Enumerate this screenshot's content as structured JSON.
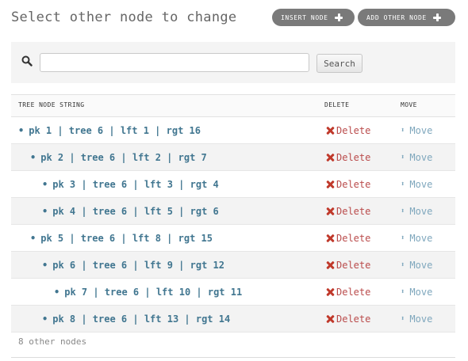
{
  "header": {
    "title": "Select other node to change",
    "insert_node_label": "INSERT NODE",
    "add_other_node_label": "ADD OTHER NODE"
  },
  "search": {
    "value": "",
    "placeholder": "",
    "button_label": "Search"
  },
  "table": {
    "columns": [
      "TREE NODE STRING",
      "DELETE",
      "MOVE"
    ],
    "rows": [
      {
        "label": "pk 1 | tree 6 | lft 1 | rgt 16",
        "depth": 0,
        "delete": "Delete",
        "move": "Move"
      },
      {
        "label": "pk 2 | tree 6 | lft 2 | rgt 7",
        "depth": 1,
        "delete": "Delete",
        "move": "Move"
      },
      {
        "label": "pk 3 | tree 6 | lft 3 | rgt 4",
        "depth": 2,
        "delete": "Delete",
        "move": "Move"
      },
      {
        "label": "pk 4 | tree 6 | lft 5 | rgt 6",
        "depth": 2,
        "delete": "Delete",
        "move": "Move"
      },
      {
        "label": "pk 5 | tree 6 | lft 8 | rgt 15",
        "depth": 1,
        "delete": "Delete",
        "move": "Move"
      },
      {
        "label": "pk 6 | tree 6 | lft 9 | rgt 12",
        "depth": 2,
        "delete": "Delete",
        "move": "Move"
      },
      {
        "label": "pk 7 | tree 6 | lft 10 | rgt 11",
        "depth": 3,
        "delete": "Delete",
        "move": "Move"
      },
      {
        "label": "pk 8 | tree 6 | lft 13 | rgt 14",
        "depth": 2,
        "delete": "Delete",
        "move": "Move"
      }
    ]
  },
  "footer": {
    "count_text": "8 other nodes"
  },
  "colors": {
    "link": "#417690",
    "delete": "#ba4b4b",
    "move": "#7fa7bd",
    "pill_button": "#7a7a7a"
  },
  "icons": {
    "search": "search-icon",
    "plus": "plus-icon",
    "delete": "cross-icon",
    "move": "updown-arrows-icon"
  }
}
